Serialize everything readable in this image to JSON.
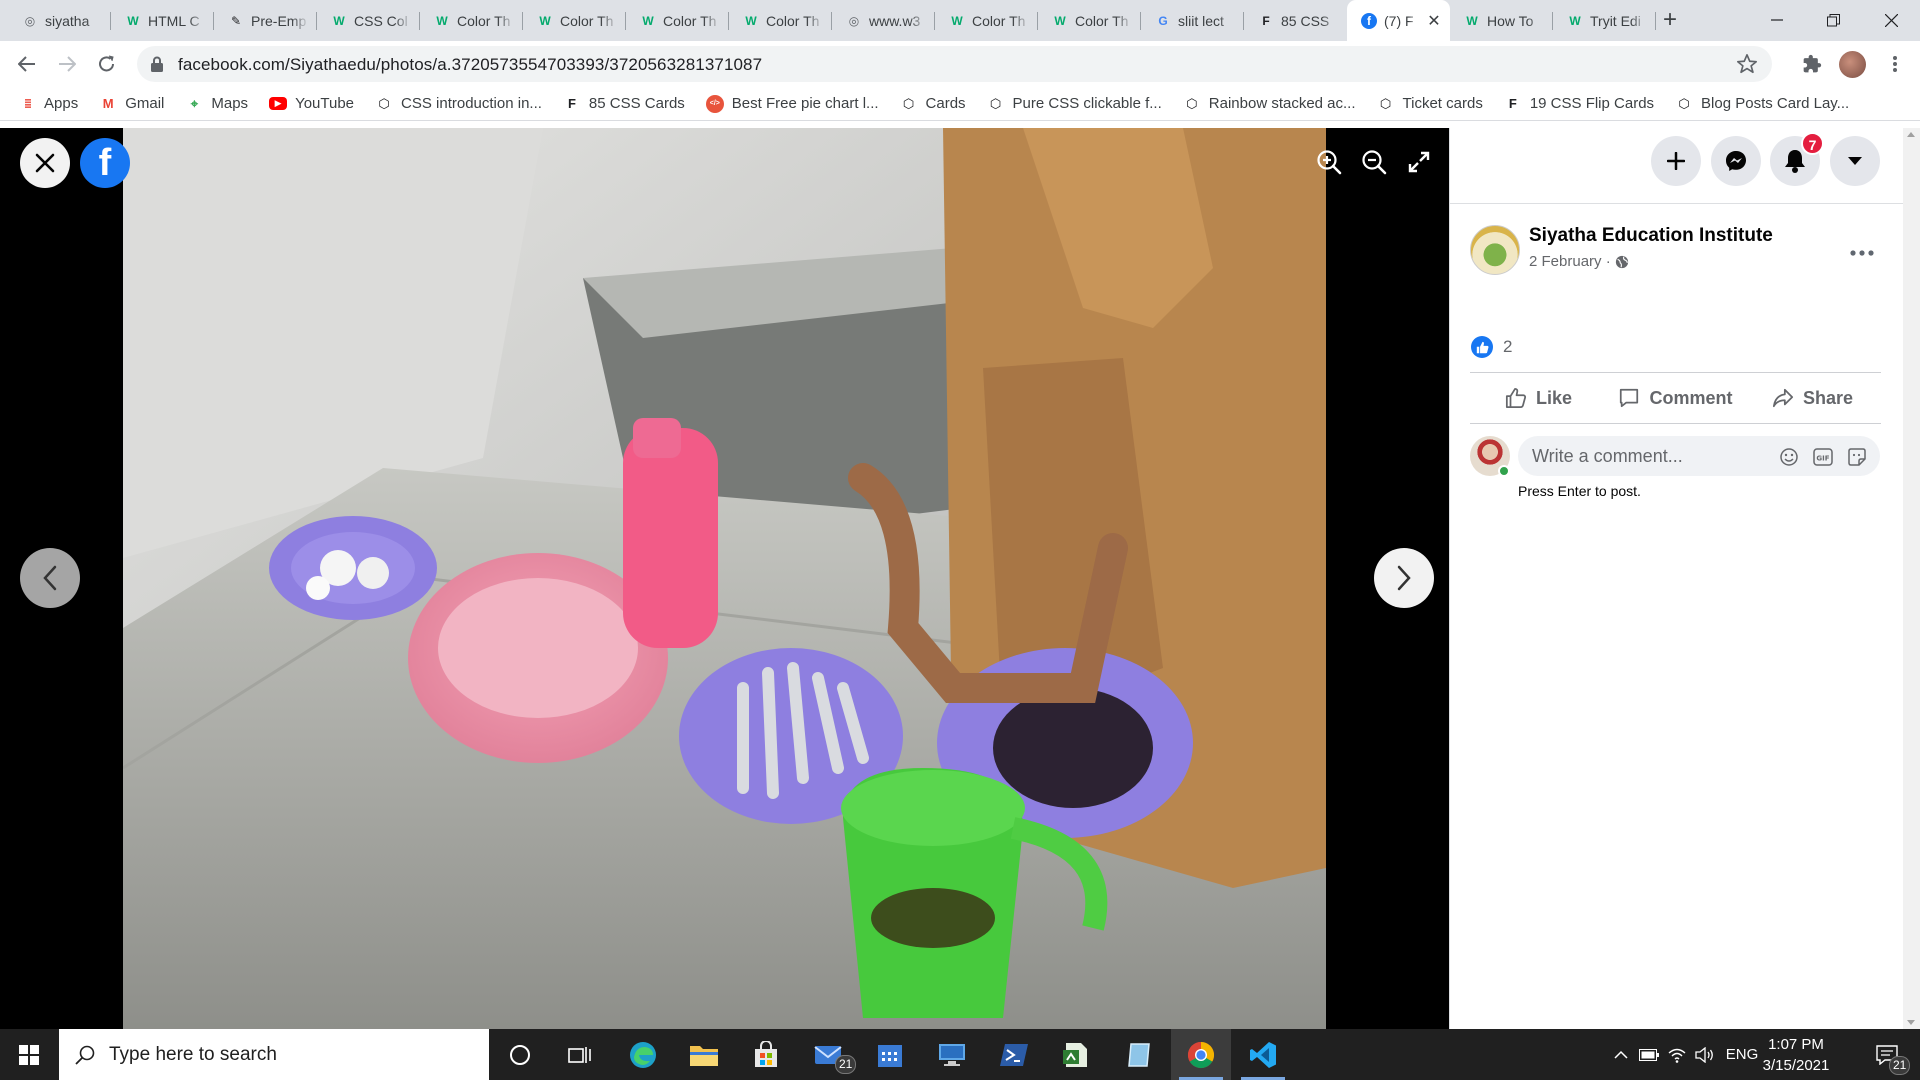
{
  "browser": {
    "tabs": [
      {
        "title": "siyatha",
        "icon": "globe-icon",
        "color": "#5f6368"
      },
      {
        "title": "HTML C",
        "icon": "w3schools-icon",
        "color": "#04aa6d"
      },
      {
        "title": "Pre-Emp",
        "icon": "pen-icon",
        "color": "#202124"
      },
      {
        "title": "CSS Col",
        "icon": "w3schools-icon",
        "color": "#04aa6d"
      },
      {
        "title": "Color Th",
        "icon": "w3schools-icon",
        "color": "#04aa6d"
      },
      {
        "title": "Color Th",
        "icon": "w3schools-icon",
        "color": "#04aa6d"
      },
      {
        "title": "Color Th",
        "icon": "w3schools-icon",
        "color": "#04aa6d"
      },
      {
        "title": "Color Th",
        "icon": "w3schools-icon",
        "color": "#04aa6d"
      },
      {
        "title": "www.w3",
        "icon": "globe-icon",
        "color": "#5f6368"
      },
      {
        "title": "Color Th",
        "icon": "w3schools-icon",
        "color": "#04aa6d"
      },
      {
        "title": "Color Th",
        "icon": "w3schools-icon",
        "color": "#04aa6d"
      },
      {
        "title": "sliit lect",
        "icon": "google-icon",
        "color": "#4285f4"
      },
      {
        "title": "85 CSS",
        "icon": "freefrontend-icon",
        "color": "#202124"
      },
      {
        "title": "(7) F",
        "icon": "facebook-icon",
        "color": "#1877f2",
        "active": true
      },
      {
        "title": "How To",
        "icon": "w3schools-icon",
        "color": "#04aa6d"
      },
      {
        "title": "Tryit Edi",
        "icon": "w3schools-icon",
        "color": "#04aa6d"
      }
    ],
    "new_tab_label": "+",
    "url": "facebook.com/Siyathaedu/photos/a.3720573554703393/3720563281371087",
    "bookmarks": [
      {
        "label": "Apps",
        "icon": "apps-grid-icon"
      },
      {
        "label": "Gmail",
        "icon": "gmail-icon"
      },
      {
        "label": "Maps",
        "icon": "maps-icon"
      },
      {
        "label": "YouTube",
        "icon": "youtube-icon"
      },
      {
        "label": "CSS introduction in...",
        "icon": "codepen-icon"
      },
      {
        "label": "85 CSS Cards",
        "icon": "freefrontend-icon"
      },
      {
        "label": "Best Free pie chart l...",
        "icon": "code-icon"
      },
      {
        "label": "Cards",
        "icon": "codepen-icon"
      },
      {
        "label": "Pure CSS clickable f...",
        "icon": "codepen-icon"
      },
      {
        "label": "Rainbow stacked ac...",
        "icon": "codepen-icon"
      },
      {
        "label": "Ticket cards",
        "icon": "codepen-icon"
      },
      {
        "label": "19 CSS Flip Cards",
        "icon": "freefrontend-icon"
      },
      {
        "label": "Blog Posts Card Lay...",
        "icon": "codepen-icon"
      }
    ]
  },
  "facebook": {
    "logo": "f",
    "notifications_count": "7",
    "post": {
      "page_name": "Siyatha Education Institute",
      "date": "2 February ·",
      "reaction_count": "2",
      "actions": {
        "like": "Like",
        "comment": "Comment",
        "share": "Share"
      },
      "comment_placeholder": "Write a comment...",
      "comment_hint": "Press Enter to post."
    }
  },
  "taskbar": {
    "search_placeholder": "Type here to search",
    "mail_badge": "21",
    "language": "ENG",
    "time": "1:07 PM",
    "date": "3/15/2021",
    "notifications_badge": "21"
  },
  "colors": {
    "facebook_blue": "#1877f2",
    "taskbar": "#202020",
    "chrome_tabstrip": "#dee1e6",
    "badge_red": "#e41e3f"
  }
}
